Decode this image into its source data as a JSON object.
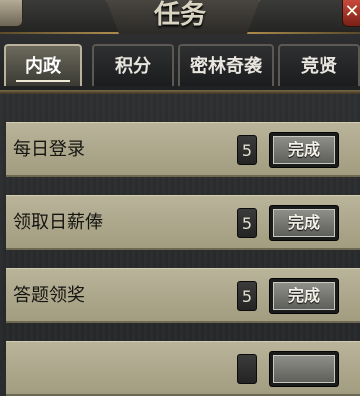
{
  "header": {
    "title": "任务",
    "close_symbol": "✕"
  },
  "tabs": [
    {
      "label": "内政",
      "active": true
    },
    {
      "label": "积分",
      "active": false
    },
    {
      "label": "密林奇袭",
      "active": false
    },
    {
      "label": "竞贤",
      "active": false
    }
  ],
  "tasks": [
    {
      "name": "每日登录",
      "count": "5",
      "button": "完成"
    },
    {
      "name": "领取日薪俸",
      "count": "5",
      "button": "完成"
    },
    {
      "name": "答题领奖",
      "count": "5",
      "button": "完成"
    },
    {
      "name": "",
      "count": "",
      "button": ""
    }
  ],
  "colors": {
    "accent_gold": "#a8894b",
    "row_bg": "#b9b49a",
    "close_red": "#c84a3c"
  }
}
